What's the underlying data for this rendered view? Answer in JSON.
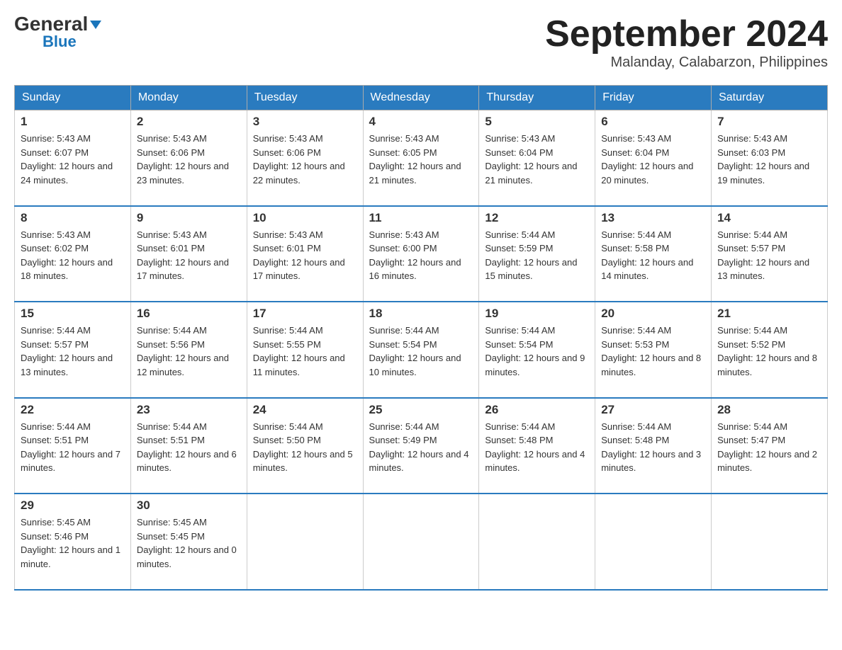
{
  "header": {
    "logo_general": "General",
    "logo_blue": "Blue",
    "month_title": "September 2024",
    "location": "Malanday, Calabarzon, Philippines"
  },
  "weekdays": [
    "Sunday",
    "Monday",
    "Tuesday",
    "Wednesday",
    "Thursday",
    "Friday",
    "Saturday"
  ],
  "weeks": [
    [
      {
        "day": "1",
        "sunrise": "5:43 AM",
        "sunset": "6:07 PM",
        "daylight": "12 hours and 24 minutes."
      },
      {
        "day": "2",
        "sunrise": "5:43 AM",
        "sunset": "6:06 PM",
        "daylight": "12 hours and 23 minutes."
      },
      {
        "day": "3",
        "sunrise": "5:43 AM",
        "sunset": "6:06 PM",
        "daylight": "12 hours and 22 minutes."
      },
      {
        "day": "4",
        "sunrise": "5:43 AM",
        "sunset": "6:05 PM",
        "daylight": "12 hours and 21 minutes."
      },
      {
        "day": "5",
        "sunrise": "5:43 AM",
        "sunset": "6:04 PM",
        "daylight": "12 hours and 21 minutes."
      },
      {
        "day": "6",
        "sunrise": "5:43 AM",
        "sunset": "6:04 PM",
        "daylight": "12 hours and 20 minutes."
      },
      {
        "day": "7",
        "sunrise": "5:43 AM",
        "sunset": "6:03 PM",
        "daylight": "12 hours and 19 minutes."
      }
    ],
    [
      {
        "day": "8",
        "sunrise": "5:43 AM",
        "sunset": "6:02 PM",
        "daylight": "12 hours and 18 minutes."
      },
      {
        "day": "9",
        "sunrise": "5:43 AM",
        "sunset": "6:01 PM",
        "daylight": "12 hours and 17 minutes."
      },
      {
        "day": "10",
        "sunrise": "5:43 AM",
        "sunset": "6:01 PM",
        "daylight": "12 hours and 17 minutes."
      },
      {
        "day": "11",
        "sunrise": "5:43 AM",
        "sunset": "6:00 PM",
        "daylight": "12 hours and 16 minutes."
      },
      {
        "day": "12",
        "sunrise": "5:44 AM",
        "sunset": "5:59 PM",
        "daylight": "12 hours and 15 minutes."
      },
      {
        "day": "13",
        "sunrise": "5:44 AM",
        "sunset": "5:58 PM",
        "daylight": "12 hours and 14 minutes."
      },
      {
        "day": "14",
        "sunrise": "5:44 AM",
        "sunset": "5:57 PM",
        "daylight": "12 hours and 13 minutes."
      }
    ],
    [
      {
        "day": "15",
        "sunrise": "5:44 AM",
        "sunset": "5:57 PM",
        "daylight": "12 hours and 13 minutes."
      },
      {
        "day": "16",
        "sunrise": "5:44 AM",
        "sunset": "5:56 PM",
        "daylight": "12 hours and 12 minutes."
      },
      {
        "day": "17",
        "sunrise": "5:44 AM",
        "sunset": "5:55 PM",
        "daylight": "12 hours and 11 minutes."
      },
      {
        "day": "18",
        "sunrise": "5:44 AM",
        "sunset": "5:54 PM",
        "daylight": "12 hours and 10 minutes."
      },
      {
        "day": "19",
        "sunrise": "5:44 AM",
        "sunset": "5:54 PM",
        "daylight": "12 hours and 9 minutes."
      },
      {
        "day": "20",
        "sunrise": "5:44 AM",
        "sunset": "5:53 PM",
        "daylight": "12 hours and 8 minutes."
      },
      {
        "day": "21",
        "sunrise": "5:44 AM",
        "sunset": "5:52 PM",
        "daylight": "12 hours and 8 minutes."
      }
    ],
    [
      {
        "day": "22",
        "sunrise": "5:44 AM",
        "sunset": "5:51 PM",
        "daylight": "12 hours and 7 minutes."
      },
      {
        "day": "23",
        "sunrise": "5:44 AM",
        "sunset": "5:51 PM",
        "daylight": "12 hours and 6 minutes."
      },
      {
        "day": "24",
        "sunrise": "5:44 AM",
        "sunset": "5:50 PM",
        "daylight": "12 hours and 5 minutes."
      },
      {
        "day": "25",
        "sunrise": "5:44 AM",
        "sunset": "5:49 PM",
        "daylight": "12 hours and 4 minutes."
      },
      {
        "day": "26",
        "sunrise": "5:44 AM",
        "sunset": "5:48 PM",
        "daylight": "12 hours and 4 minutes."
      },
      {
        "day": "27",
        "sunrise": "5:44 AM",
        "sunset": "5:48 PM",
        "daylight": "12 hours and 3 minutes."
      },
      {
        "day": "28",
        "sunrise": "5:44 AM",
        "sunset": "5:47 PM",
        "daylight": "12 hours and 2 minutes."
      }
    ],
    [
      {
        "day": "29",
        "sunrise": "5:45 AM",
        "sunset": "5:46 PM",
        "daylight": "12 hours and 1 minute."
      },
      {
        "day": "30",
        "sunrise": "5:45 AM",
        "sunset": "5:45 PM",
        "daylight": "12 hours and 0 minutes."
      },
      null,
      null,
      null,
      null,
      null
    ]
  ]
}
